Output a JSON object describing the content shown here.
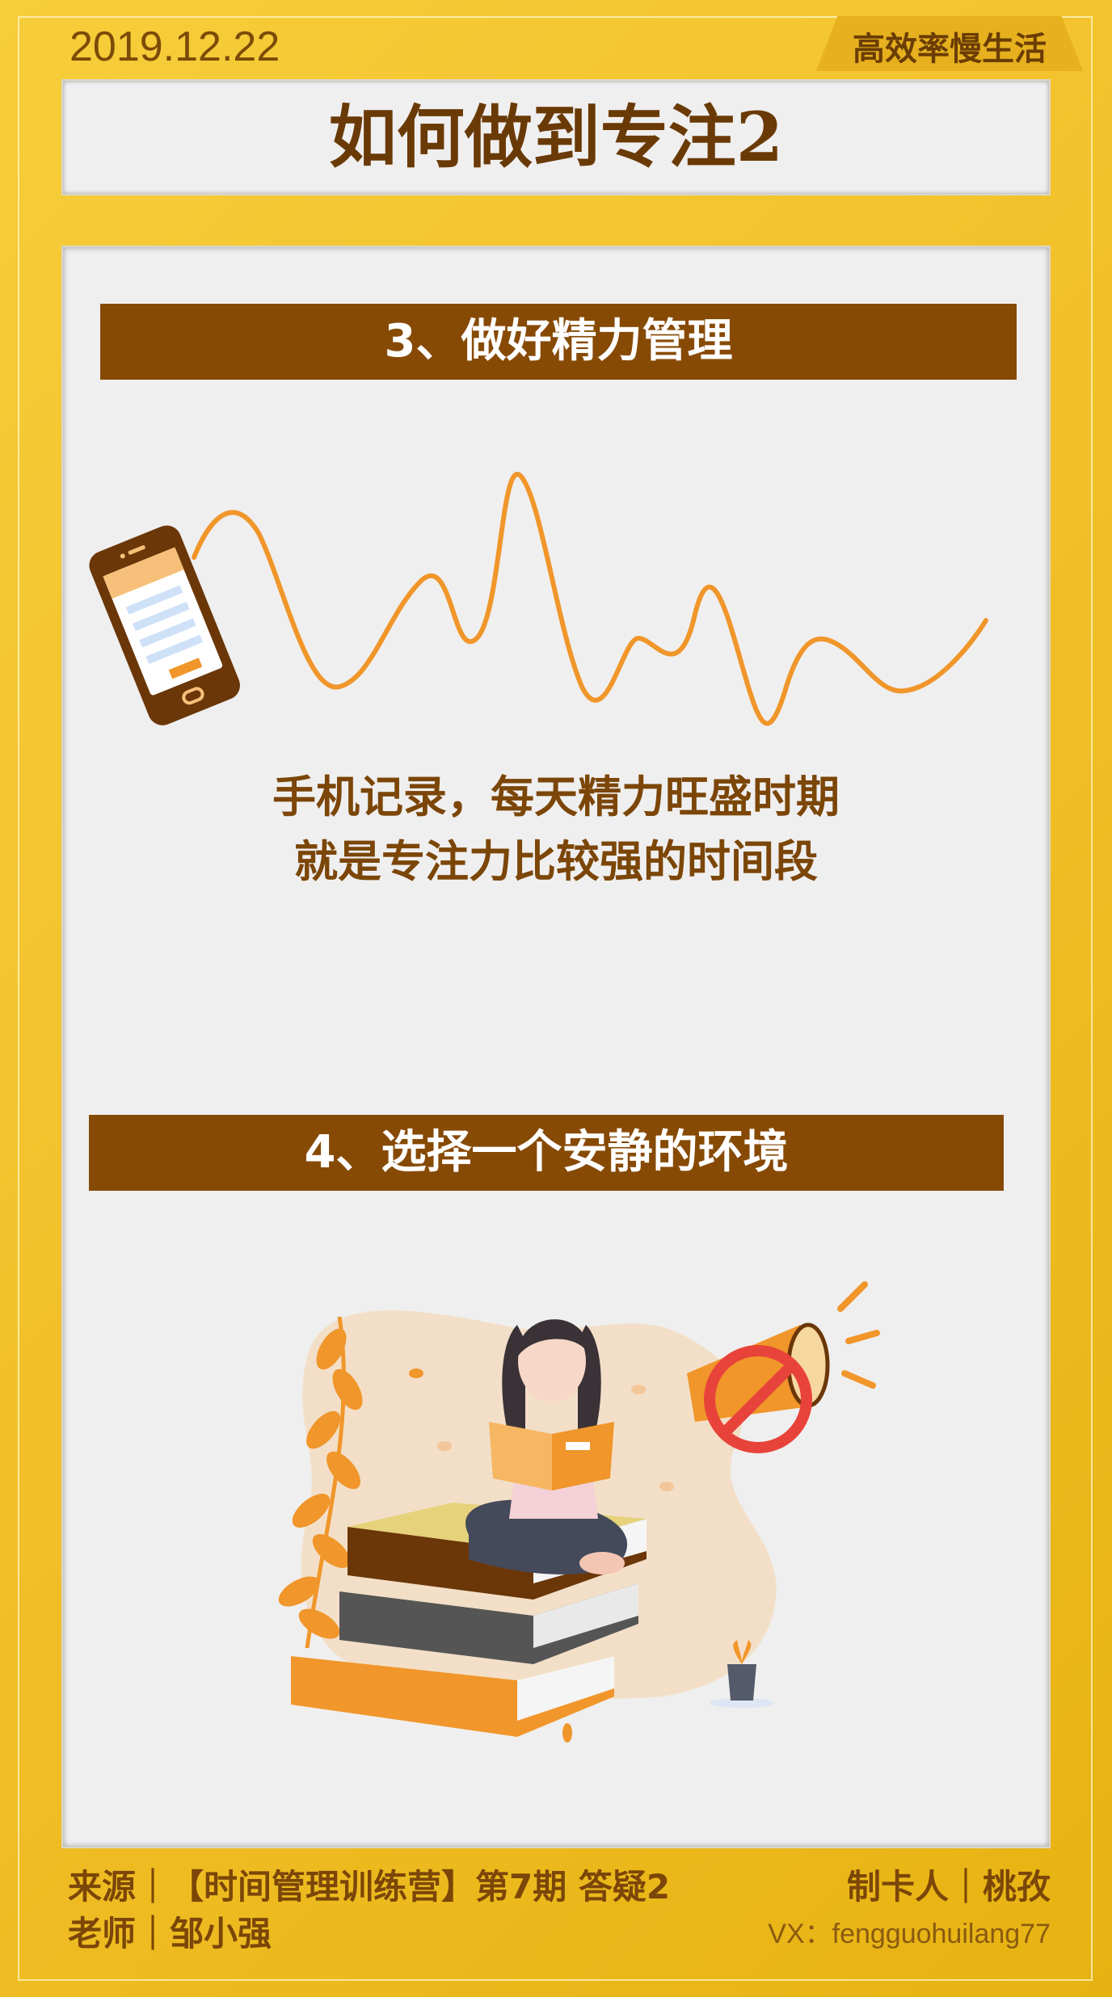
{
  "header": {
    "date": "2019.12.22",
    "brand": "高效率慢生活",
    "title": "如何做到专注2"
  },
  "sections": [
    {
      "heading": "3、做好精力管理",
      "caption_line1": "手机记录，每天精力旺盛时期",
      "caption_line2": "就是专注力比较强的时间段"
    },
    {
      "heading": "4、选择一个安静的环境"
    }
  ],
  "footer": {
    "source": "来源｜【时间管理训练营】第7期  答疑2",
    "teacher": "老师｜邹小强",
    "maker": "制卡人｜桃孜",
    "vx": "VX：fengguohuilang77"
  },
  "colors": {
    "background": "#f2c12a",
    "banner": "#874a05",
    "text_brown": "#7b4608",
    "wave": "#f0962a"
  },
  "icons": [
    "phone-icon",
    "energy-wave",
    "reading-girl-illustration",
    "no-noise-megaphone-icon",
    "plant-icon",
    "book-stack"
  ]
}
